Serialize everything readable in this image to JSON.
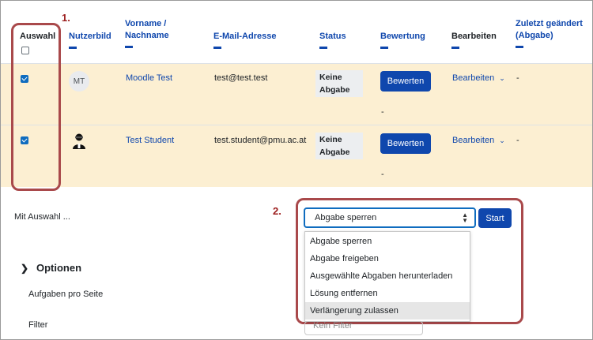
{
  "table": {
    "headers": {
      "select": "Auswahl",
      "picture": "Nutzerbild",
      "name": "Vorname / Nachname",
      "email": "E-Mail-Adresse",
      "status": "Status",
      "grade": "Bewertung",
      "edit": "Bearbeiten",
      "modified": "Zuletzt geändert (Abgabe)"
    },
    "rows": [
      {
        "initials": "MT",
        "name": "Moodle Test",
        "email": "test@test.test",
        "status": "Keine Abgabe",
        "grade_button": "Bewerten",
        "edit": "Bearbeiten",
        "modified": "-",
        "extra": "-",
        "checked": true
      },
      {
        "initials": "",
        "name": "Test Student",
        "email": "test.student@pmu.ac.at",
        "status": "Keine Abgabe",
        "grade_button": "Bewerten",
        "edit": "Bearbeiten",
        "modified": "-",
        "extra": "-",
        "checked": true
      }
    ]
  },
  "annotations": {
    "step1": "1.",
    "step2": "2."
  },
  "bulk": {
    "label": "Mit Auswahl ...",
    "selected": "Abgabe sperren",
    "start_button": "Start",
    "options": [
      "Abgabe sperren",
      "Abgabe freigeben",
      "Ausgewählte Abgaben herunterladen",
      "Lösung entfernen",
      "Verlängerung zulassen"
    ],
    "highlighted_index": 4
  },
  "options_section": {
    "title": "Optionen",
    "per_page_label": "Aufgaben pro Seite",
    "filter_label": "Filter",
    "filter_value": "Kein Filter"
  },
  "colors": {
    "primary": "#0f47ad",
    "row_highlight": "#fcefd2",
    "annotation": "#a9494b"
  }
}
